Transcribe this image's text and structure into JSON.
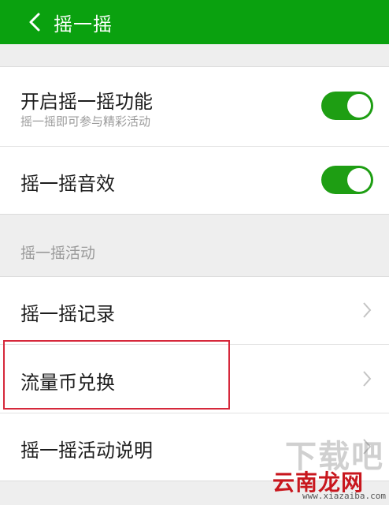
{
  "header": {
    "title": "摇一摇",
    "back_icon": "chevron-left-icon"
  },
  "settings": {
    "enable": {
      "label": "开启摇一摇功能",
      "subtitle": "摇一摇即可参与精彩活动",
      "toggle_on": true
    },
    "sound": {
      "label": "摇一摇音效",
      "toggle_on": true
    }
  },
  "activities": {
    "section_title": "摇一摇活动",
    "items": [
      {
        "label": "摇一摇记录"
      },
      {
        "label": "流量币兑换"
      },
      {
        "label": "摇一摇活动说明"
      }
    ]
  },
  "watermark": {
    "big_text": "下载吧",
    "brand": "云南龙网",
    "url": "www.xiazaiba.com"
  },
  "colors": {
    "header_bg": "#0aa10f",
    "toggle_on": "#1e9e13",
    "highlight": "#d6283b"
  }
}
